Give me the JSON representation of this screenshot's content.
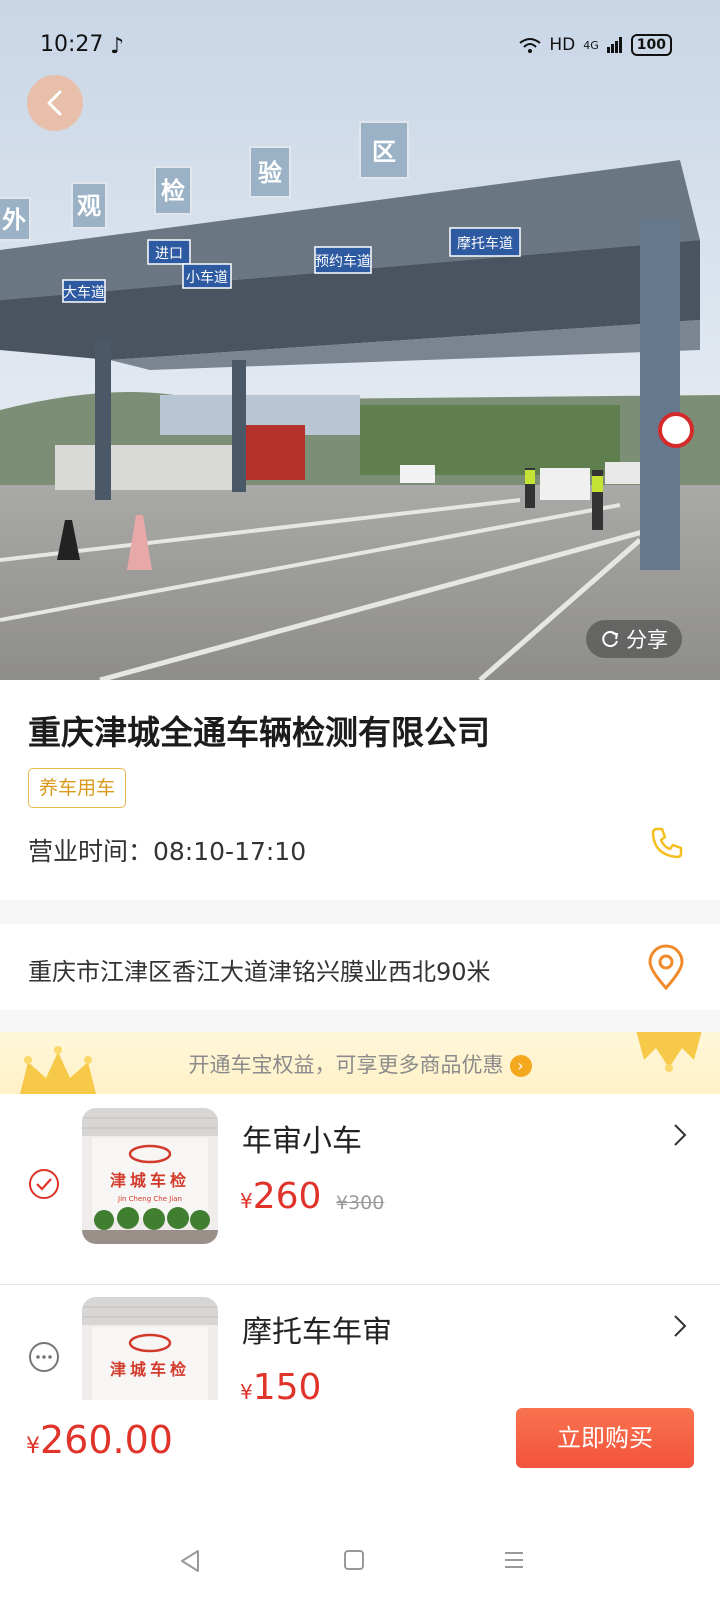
{
  "status_bar": {
    "time": "10:27",
    "note_icon": "music-note-icon",
    "network": "HD",
    "signal": "4G",
    "battery": "100"
  },
  "hero": {
    "photo_signs": [
      "外",
      "观",
      "检",
      "验",
      "区"
    ],
    "lane_signs": [
      "大车道",
      "进口",
      "小车道",
      "预约车道",
      "摩托车道"
    ],
    "share_label": "分享"
  },
  "shop": {
    "name": "重庆津城全通车辆检测有限公司",
    "tag": "养车用车",
    "hours": "营业时间：08:10-17:10",
    "address": "重庆市江津区香江大道津铭兴膜业西北90米"
  },
  "promo": {
    "text": "开通车宝权益，可享更多商品优惠"
  },
  "thumb_signage": {
    "title": "津城车检",
    "pinyin": "Jin Cheng Che Jian"
  },
  "products": [
    {
      "name": "年审小车",
      "currency": "¥",
      "price": "260",
      "original_price": "¥300",
      "selected": true
    },
    {
      "name": "摩托车年审",
      "currency": "¥",
      "price": "150",
      "original_price": "",
      "selected": false
    }
  ],
  "checkout": {
    "currency": "¥",
    "total": "260.00",
    "buy_label": "立即购买"
  },
  "colors": {
    "accent_red": "#e0332a",
    "accent_orange": "#f2533c",
    "tag_gold": "#e9b94f",
    "icon_yellow": "#f4c021"
  }
}
